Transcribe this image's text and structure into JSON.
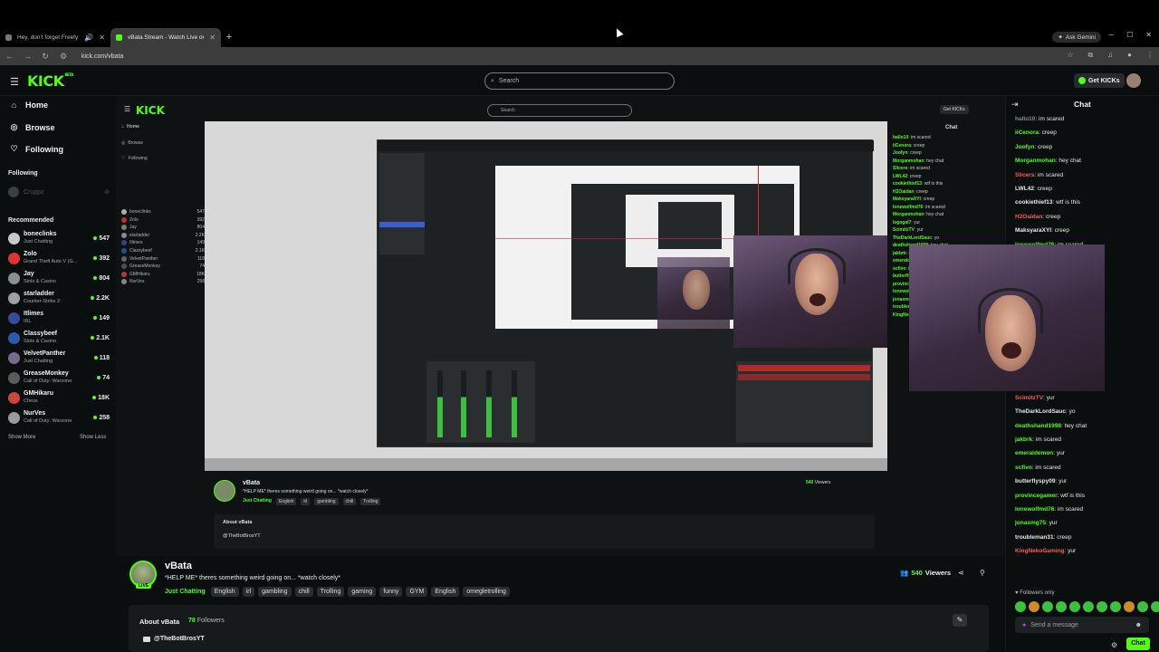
{
  "browser": {
    "tabs": [
      {
        "title": "Hey, don't forget Freefy!"
      },
      {
        "title": "vBata Stream - Watch Live on K"
      }
    ],
    "ask_gemini": "Ask Gemini",
    "url": "kick.com/vbata"
  },
  "header": {
    "logo": "KICK",
    "logo_badge": "BETA",
    "search_placeholder": "Search",
    "get_kicks": "Get KICKs"
  },
  "sidebar": {
    "nav": [
      {
        "label": "Home",
        "icon": "home-icon"
      },
      {
        "label": "Browse",
        "icon": "compass-icon"
      },
      {
        "label": "Following",
        "icon": "heart-icon"
      }
    ],
    "following_title": "Following",
    "following": [
      {
        "name": "Cruppz"
      }
    ],
    "recommended_title": "Recommended",
    "recommended": [
      {
        "name": "boneclinks",
        "category": "Just Chatting",
        "viewers": "547",
        "color": "#c9c9c9"
      },
      {
        "name": "Zolo",
        "category": "Grand Theft Auto V (G...",
        "viewers": "392",
        "color": "#d33"
      },
      {
        "name": "Jay",
        "category": "Slots & Casino",
        "viewers": "804",
        "color": "#8a8f94"
      },
      {
        "name": "starladder",
        "category": "Counter-Strike 2",
        "viewers": "2.2K",
        "color": "#a0a0a0"
      },
      {
        "name": "Itlimes",
        "category": "IRL",
        "viewers": "149",
        "color": "#3a4a9a"
      },
      {
        "name": "Classybeef",
        "category": "Slots & Casino",
        "viewers": "2.1K",
        "color": "#2a5aa8"
      },
      {
        "name": "VelvetPanther",
        "category": "Just Chatting",
        "viewers": "118",
        "color": "#7a6a8a"
      },
      {
        "name": "GreaseMonkey",
        "category": "Call of Duty: Warzone",
        "viewers": "74",
        "color": "#5a5a5a"
      },
      {
        "name": "GMHikaru",
        "category": "Chess",
        "viewers": "18K",
        "color": "#c44"
      },
      {
        "name": "NurVes",
        "category": "Call of Duty: Warzone",
        "viewers": "258",
        "color": "#9a9a9a"
      }
    ],
    "show_more": "Show More",
    "show_less": "Show Less"
  },
  "stream": {
    "channel": "vBata",
    "live_badge": "LIVE",
    "title": "*HELP ME* theres something weird going on... *watch closely*",
    "category": "Just Chatting",
    "tags": [
      "English",
      "irl",
      "gambling",
      "chill",
      "Trolling",
      "gaming",
      "funny",
      "GYM",
      "English",
      "omegletrolling"
    ],
    "viewers": "540",
    "viewers_label": "Viewers",
    "about_title": "About vBata",
    "followers_count": "78",
    "followers_label": "Followers",
    "youtube": "@TheBotBrosYT"
  },
  "chat": {
    "title": "Chat",
    "messages": [
      {
        "user": "hallo10",
        "text": "im scared",
        "color": "#8e8e8e"
      },
      {
        "user": "iiCenora",
        "text": "creep",
        "color": "#53fc18"
      },
      {
        "user": "Joofyn",
        "text": "creep",
        "color": "#53fc18"
      },
      {
        "user": "Morganmohan",
        "text": "hey chat",
        "color": "#53fc18"
      },
      {
        "user": "Slicers",
        "text": "im scared",
        "color": "#ff5b5b"
      },
      {
        "user": "LWL42",
        "text": "creep",
        "color": "#e8e8e8"
      },
      {
        "user": "cookiethief13",
        "text": "wtf is this",
        "color": "#e8e8e8"
      },
      {
        "user": "H2Oaidan",
        "text": "creep",
        "color": "#ff5b5b"
      },
      {
        "user": "MaksyaraXYI",
        "text": "creep",
        "color": "#e8e8e8"
      },
      {
        "user": "lonewolfmd76",
        "text": "im scared",
        "color": "#53fc18"
      },
      {
        "user": "",
        "text": "",
        "color": "#e8e8e8"
      },
      {
        "user": "",
        "text": "",
        "color": "#e8e8e8"
      },
      {
        "user": "",
        "text": "",
        "color": "#e8e8e8"
      },
      {
        "user": "",
        "text": "",
        "color": "#e8e8e8"
      },
      {
        "user": "",
        "text": "",
        "color": "#e8e8e8"
      },
      {
        "user": "",
        "text": "",
        "color": "#e8e8e8"
      },
      {
        "user": "",
        "text": "",
        "color": "#e8e8e8"
      },
      {
        "user": "",
        "text": "",
        "color": "#e8e8e8"
      },
      {
        "user": "Morganmohan",
        "text": "hey chat",
        "color": "#53fc18"
      },
      {
        "user": "legogal7",
        "text": "yur",
        "color": "#53fc18"
      },
      {
        "user": "ScimitzTV",
        "text": "yur",
        "color": "#ff5b5b"
      },
      {
        "user": "TheDarkLordSauc",
        "text": "yo",
        "color": "#e8e8e8"
      },
      {
        "user": "deathshand1998",
        "text": "hey chat",
        "color": "#53fc18"
      },
      {
        "user": "jakbrk",
        "text": "im scared",
        "color": "#53fc18"
      },
      {
        "user": "emeraldemon",
        "text": "yur",
        "color": "#53fc18"
      },
      {
        "user": "scfivo",
        "text": "im scared",
        "color": "#53fc18"
      },
      {
        "user": "butterflyspy09",
        "text": "yur",
        "color": "#e8e8e8"
      },
      {
        "user": "provincegamer",
        "text": "wtf is this",
        "color": "#53fc18"
      },
      {
        "user": "lonewolfmd76",
        "text": "im scared",
        "color": "#53fc18"
      },
      {
        "user": "jonasmg75",
        "text": "yur",
        "color": "#53fc18"
      },
      {
        "user": "troubleman31",
        "text": "creep",
        "color": "#e8e8e8"
      },
      {
        "user": "KingNekoGaming",
        "text": "yur",
        "color": "#ff5b5b"
      }
    ],
    "followers_only": "Followers only",
    "input_placeholder": "Send a message",
    "send_label": "Chat"
  },
  "colors": {
    "accent": "#53fc18",
    "background": "#0b0e0f"
  }
}
